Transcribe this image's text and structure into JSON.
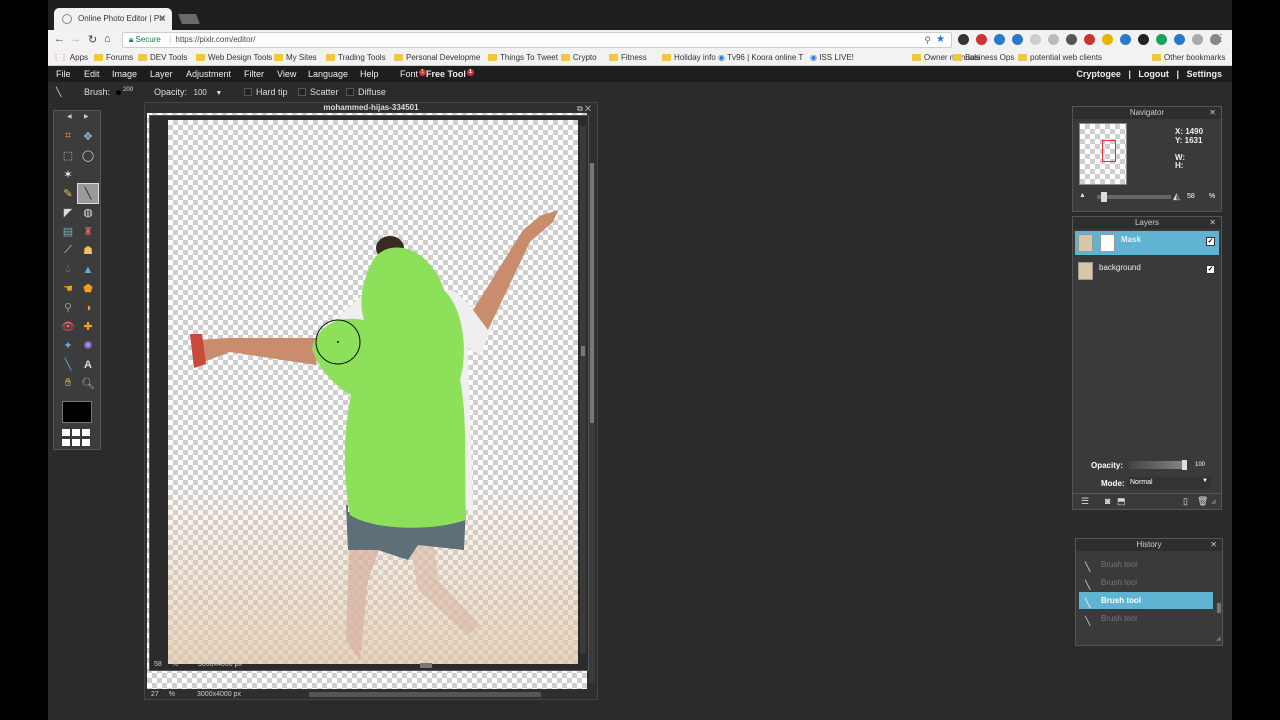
{
  "browser": {
    "tab_title": "Online Photo Editor | Pix",
    "omnibox": {
      "secure_label": "Secure",
      "url": "https://pixlr.com/editor/"
    },
    "bookmarks": [
      {
        "label": "Apps",
        "type": "apps"
      },
      {
        "label": "Forums",
        "type": "folder"
      },
      {
        "label": "DEV Tools",
        "type": "folder"
      },
      {
        "label": "Web Design Tools",
        "type": "folder"
      },
      {
        "label": "My Sites",
        "type": "folder"
      },
      {
        "label": "Trading Tools",
        "type": "folder"
      },
      {
        "label": "Personal Developme",
        "type": "folder"
      },
      {
        "label": "Things To Tweet",
        "type": "folder"
      },
      {
        "label": "Crypto",
        "type": "folder"
      },
      {
        "label": "Fitness",
        "type": "folder"
      },
      {
        "label": "Holiday info",
        "type": "folder"
      },
      {
        "label": "Tv96 | Koora online T",
        "type": "page"
      },
      {
        "label": "ISS LIVE!",
        "type": "page"
      },
      {
        "label": "Owner manuals",
        "type": "folder"
      },
      {
        "label": "Business Ops",
        "type": "folder"
      },
      {
        "label": "potential web clients",
        "type": "folder"
      },
      {
        "label": "Other bookmarks",
        "type": "folder"
      }
    ]
  },
  "app": {
    "menu": [
      "File",
      "Edit",
      "Image",
      "Layer",
      "Adjustment",
      "Filter",
      "View",
      "Language",
      "Help"
    ],
    "menu_font": "Font",
    "menu_free_tool": "Free Tool",
    "badge_count": "1",
    "user": {
      "name": "Cryptogee",
      "logout": "Logout",
      "settings": "Settings",
      "sep": "|"
    },
    "options": {
      "brush_label": "Brush:",
      "brush_size": "200",
      "opacity_label": "Opacity:",
      "opacity_value": "100",
      "hard_tip": "Hard tip",
      "scatter": "Scatter",
      "diffuse": "Diffuse"
    },
    "document": {
      "title": "mohammed-hijas-334501",
      "inner_zoom": "58",
      "outer_zoom": "27",
      "zoom_unit": "%",
      "size": "3000x4000 px"
    },
    "foreground_color": "#000000"
  },
  "navigator": {
    "title": "Navigator",
    "x_label": "X:",
    "x_value": "1490",
    "y_label": "Y:",
    "y_value": "1631",
    "w_label": "W:",
    "h_label": "H:",
    "zoom": "58",
    "zoom_unit": "%"
  },
  "layers": {
    "title": "Layers",
    "items": [
      {
        "name": "Mask",
        "active": true
      },
      {
        "name": "background",
        "active": false
      }
    ],
    "opacity_label": "Opacity:",
    "opacity_value": "100",
    "mode_label": "Mode:",
    "mode_value": "Normal"
  },
  "history": {
    "title": "History",
    "items": [
      {
        "label": "Brush tool"
      },
      {
        "label": "Brush tool"
      },
      {
        "label": "Brush tool",
        "active": true
      },
      {
        "label": "Brush tool"
      }
    ]
  },
  "colors": {
    "accent": "#5fb4d4",
    "mask_green": "#8de05a"
  }
}
